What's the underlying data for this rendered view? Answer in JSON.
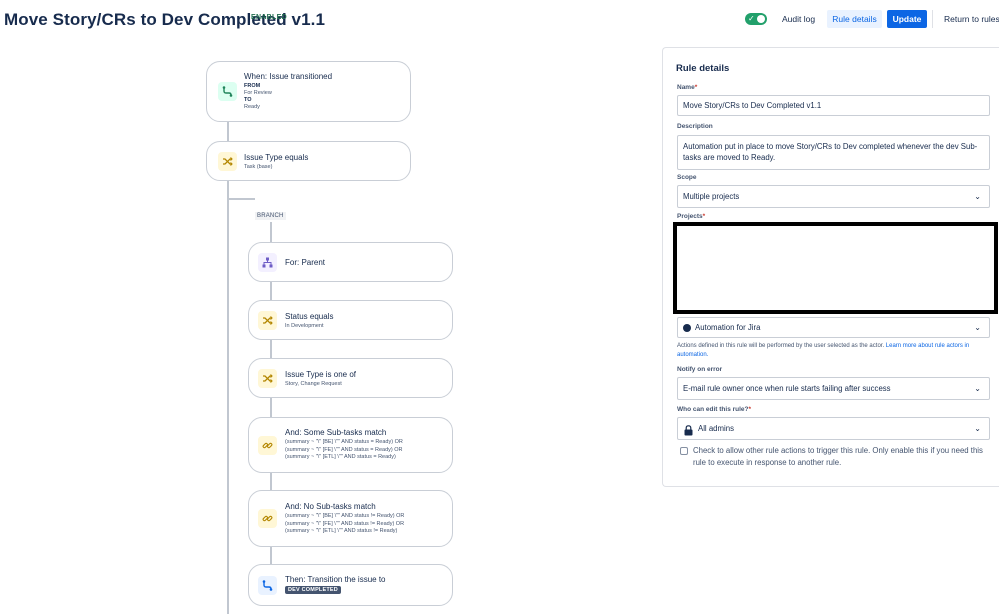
{
  "header": {
    "title": "Move Story/CRs to Dev Completed v1.1",
    "status_badge": "ENABLED",
    "toggle_on": true,
    "audit_log": "Audit log",
    "rule_details": "Rule details",
    "update": "Update",
    "return_to_rules": "Return to rules"
  },
  "flow": {
    "trigger": {
      "title": "When: Issue transitioned",
      "from_label": "FROM",
      "from_value": "For Review",
      "to_label": "TO",
      "to_value": "Ready"
    },
    "condition1": {
      "title": "Issue Type equals",
      "sub": "Task (base)"
    },
    "branch_label": "BRANCH",
    "branch": {
      "title": "For: Parent"
    },
    "status_cond": {
      "title": "Status equals",
      "sub": "In Development"
    },
    "type_cond": {
      "title": "Issue Type is one of",
      "sub": "Story, Change Request"
    },
    "some_subtasks": {
      "title": "And: Some Sub-tasks match",
      "lines": [
        "(summary ~ \"\\\" [BE] \\\"\" AND status = Ready) OR",
        "(summary ~ \"\\\" [FE] \\\"\" AND status = Ready) OR",
        "(summary ~ \"\\\" [ETL] \\\"\" AND status = Ready)"
      ]
    },
    "no_subtasks": {
      "title": "And: No Sub-tasks match",
      "lines": [
        "(summary ~ \"\\\" [BE] \\\"\" AND status != Ready) OR",
        "(summary ~ \"\\\" [FE] \\\"\" AND status != Ready) OR",
        "(summary ~ \"\\\" [ETL] \\\"\" AND status != Ready)"
      ]
    },
    "action": {
      "title": "Then: Transition the issue to",
      "lozenge": "DEV COMPLETED"
    }
  },
  "panel": {
    "heading": "Rule details",
    "name_label": "Name",
    "name_value": "Move Story/CRs to Dev Completed v1.1",
    "description_label": "Description",
    "description_value": "Automation put in place to move Story/CRs to Dev completed whenever the dev Sub-tasks are moved to Ready.",
    "scope_label": "Scope",
    "scope_value": "Multiple projects",
    "projects_label": "Projects",
    "actor_value": "Automation for Jira",
    "actor_note": "Actions defined in this rule will be performed by the user selected as the actor.",
    "actor_link": "Learn more about rule actors in automation.",
    "notify_label": "Notify on error",
    "notify_value": "E-mail rule owner once when rule starts failing after success",
    "edit_label": "Who can edit this rule?",
    "edit_value": "All admins",
    "checkbox_text": "Check to allow other rule actions to trigger this rule. Only enable this if you need this rule to execute in response to another rule.",
    "checkbox_checked": false
  },
  "required_mark": "*",
  "colors": {
    "accent": "#0c66e4",
    "toggle_on": "#22a06b",
    "enabled_text": "#216e4e",
    "lozenge_bg": "#44546f"
  }
}
